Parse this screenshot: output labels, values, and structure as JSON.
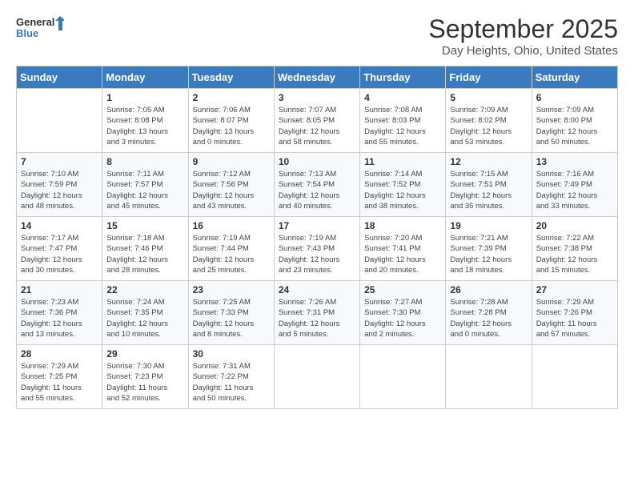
{
  "logo": {
    "line1": "General",
    "line2": "Blue"
  },
  "title": "September 2025",
  "subtitle": "Day Heights, Ohio, United States",
  "days_of_week": [
    "Sunday",
    "Monday",
    "Tuesday",
    "Wednesday",
    "Thursday",
    "Friday",
    "Saturday"
  ],
  "weeks": [
    [
      {
        "day": "",
        "info": ""
      },
      {
        "day": "1",
        "info": "Sunrise: 7:05 AM\nSunset: 8:08 PM\nDaylight: 13 hours\nand 3 minutes."
      },
      {
        "day": "2",
        "info": "Sunrise: 7:06 AM\nSunset: 8:07 PM\nDaylight: 13 hours\nand 0 minutes."
      },
      {
        "day": "3",
        "info": "Sunrise: 7:07 AM\nSunset: 8:05 PM\nDaylight: 12 hours\nand 58 minutes."
      },
      {
        "day": "4",
        "info": "Sunrise: 7:08 AM\nSunset: 8:03 PM\nDaylight: 12 hours\nand 55 minutes."
      },
      {
        "day": "5",
        "info": "Sunrise: 7:09 AM\nSunset: 8:02 PM\nDaylight: 12 hours\nand 53 minutes."
      },
      {
        "day": "6",
        "info": "Sunrise: 7:09 AM\nSunset: 8:00 PM\nDaylight: 12 hours\nand 50 minutes."
      }
    ],
    [
      {
        "day": "7",
        "info": "Sunrise: 7:10 AM\nSunset: 7:59 PM\nDaylight: 12 hours\nand 48 minutes."
      },
      {
        "day": "8",
        "info": "Sunrise: 7:11 AM\nSunset: 7:57 PM\nDaylight: 12 hours\nand 45 minutes."
      },
      {
        "day": "9",
        "info": "Sunrise: 7:12 AM\nSunset: 7:56 PM\nDaylight: 12 hours\nand 43 minutes."
      },
      {
        "day": "10",
        "info": "Sunrise: 7:13 AM\nSunset: 7:54 PM\nDaylight: 12 hours\nand 40 minutes."
      },
      {
        "day": "11",
        "info": "Sunrise: 7:14 AM\nSunset: 7:52 PM\nDaylight: 12 hours\nand 38 minutes."
      },
      {
        "day": "12",
        "info": "Sunrise: 7:15 AM\nSunset: 7:51 PM\nDaylight: 12 hours\nand 35 minutes."
      },
      {
        "day": "13",
        "info": "Sunrise: 7:16 AM\nSunset: 7:49 PM\nDaylight: 12 hours\nand 33 minutes."
      }
    ],
    [
      {
        "day": "14",
        "info": "Sunrise: 7:17 AM\nSunset: 7:47 PM\nDaylight: 12 hours\nand 30 minutes."
      },
      {
        "day": "15",
        "info": "Sunrise: 7:18 AM\nSunset: 7:46 PM\nDaylight: 12 hours\nand 28 minutes."
      },
      {
        "day": "16",
        "info": "Sunrise: 7:19 AM\nSunset: 7:44 PM\nDaylight: 12 hours\nand 25 minutes."
      },
      {
        "day": "17",
        "info": "Sunrise: 7:19 AM\nSunset: 7:43 PM\nDaylight: 12 hours\nand 23 minutes."
      },
      {
        "day": "18",
        "info": "Sunrise: 7:20 AM\nSunset: 7:41 PM\nDaylight: 12 hours\nand 20 minutes."
      },
      {
        "day": "19",
        "info": "Sunrise: 7:21 AM\nSunset: 7:39 PM\nDaylight: 12 hours\nand 18 minutes."
      },
      {
        "day": "20",
        "info": "Sunrise: 7:22 AM\nSunset: 7:38 PM\nDaylight: 12 hours\nand 15 minutes."
      }
    ],
    [
      {
        "day": "21",
        "info": "Sunrise: 7:23 AM\nSunset: 7:36 PM\nDaylight: 12 hours\nand 13 minutes."
      },
      {
        "day": "22",
        "info": "Sunrise: 7:24 AM\nSunset: 7:35 PM\nDaylight: 12 hours\nand 10 minutes."
      },
      {
        "day": "23",
        "info": "Sunrise: 7:25 AM\nSunset: 7:33 PM\nDaylight: 12 hours\nand 8 minutes."
      },
      {
        "day": "24",
        "info": "Sunrise: 7:26 AM\nSunset: 7:31 PM\nDaylight: 12 hours\nand 5 minutes."
      },
      {
        "day": "25",
        "info": "Sunrise: 7:27 AM\nSunset: 7:30 PM\nDaylight: 12 hours\nand 2 minutes."
      },
      {
        "day": "26",
        "info": "Sunrise: 7:28 AM\nSunset: 7:28 PM\nDaylight: 12 hours\nand 0 minutes."
      },
      {
        "day": "27",
        "info": "Sunrise: 7:29 AM\nSunset: 7:26 PM\nDaylight: 11 hours\nand 57 minutes."
      }
    ],
    [
      {
        "day": "28",
        "info": "Sunrise: 7:29 AM\nSunset: 7:25 PM\nDaylight: 11 hours\nand 55 minutes."
      },
      {
        "day": "29",
        "info": "Sunrise: 7:30 AM\nSunset: 7:23 PM\nDaylight: 11 hours\nand 52 minutes."
      },
      {
        "day": "30",
        "info": "Sunrise: 7:31 AM\nSunset: 7:22 PM\nDaylight: 11 hours\nand 50 minutes."
      },
      {
        "day": "",
        "info": ""
      },
      {
        "day": "",
        "info": ""
      },
      {
        "day": "",
        "info": ""
      },
      {
        "day": "",
        "info": ""
      }
    ]
  ]
}
